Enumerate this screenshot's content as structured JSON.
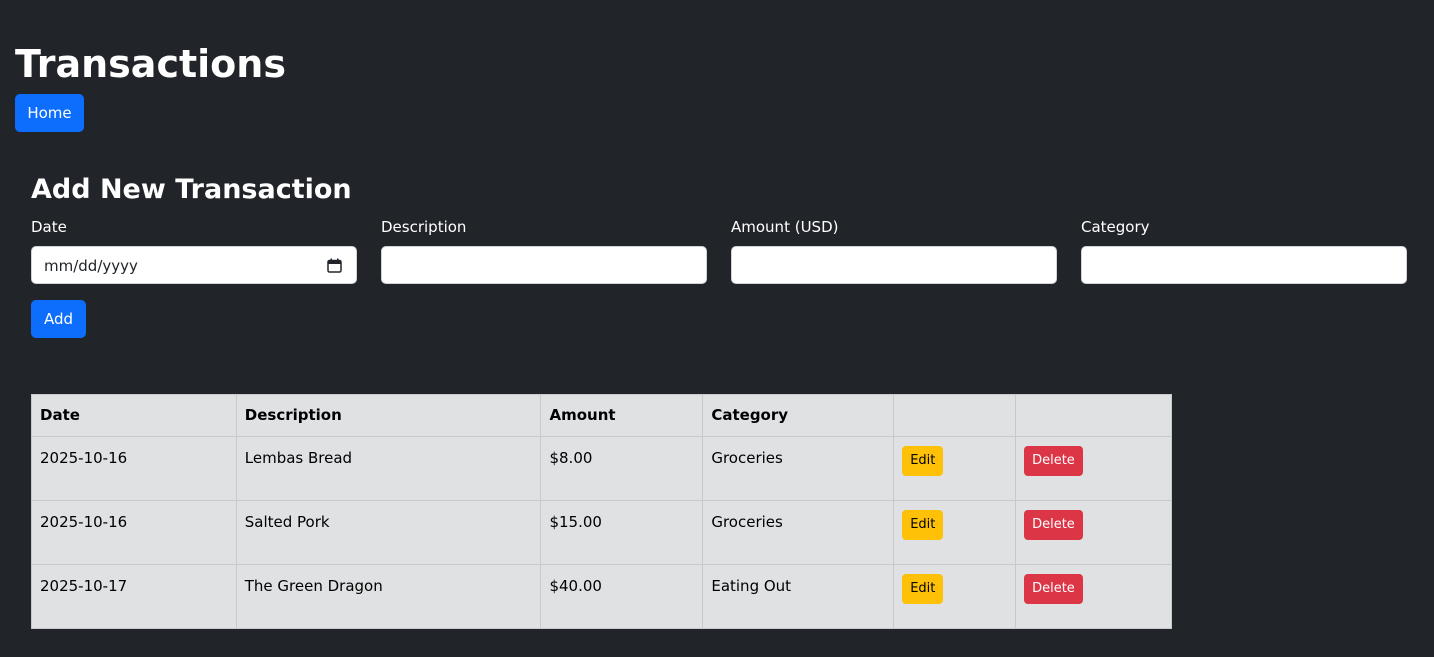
{
  "page": {
    "title": "Transactions"
  },
  "nav": {
    "home_label": "Home"
  },
  "form": {
    "title": "Add New Transaction",
    "fields": [
      {
        "label": "Date",
        "placeholder": "mm/dd/yyyy",
        "value": ""
      },
      {
        "label": "Description",
        "placeholder": "",
        "value": ""
      },
      {
        "label": "Amount (USD)",
        "placeholder": "",
        "value": ""
      },
      {
        "label": "Category",
        "placeholder": "",
        "value": ""
      }
    ],
    "submit_label": "Add"
  },
  "table": {
    "headers": [
      "Date",
      "Description",
      "Amount",
      "Category",
      "",
      ""
    ],
    "rows": [
      {
        "date": "2025-10-16",
        "description": "Lembas Bread",
        "amount": "$8.00",
        "category": "Groceries",
        "edit_label": "Edit",
        "delete_label": "Delete"
      },
      {
        "date": "2025-10-16",
        "description": "Salted Pork",
        "amount": "$15.00",
        "category": "Groceries",
        "edit_label": "Edit",
        "delete_label": "Delete"
      },
      {
        "date": "2025-10-17",
        "description": "The Green Dragon",
        "amount": "$40.00",
        "category": "Eating Out",
        "edit_label": "Edit",
        "delete_label": "Delete"
      }
    ]
  },
  "icons": {
    "date_picker": "calendar-icon"
  },
  "colors": {
    "background": "#212529",
    "primary": "#0d6efd",
    "warning": "#ffc107",
    "danger": "#dc3545",
    "table_bg": "#e0e1e3"
  }
}
